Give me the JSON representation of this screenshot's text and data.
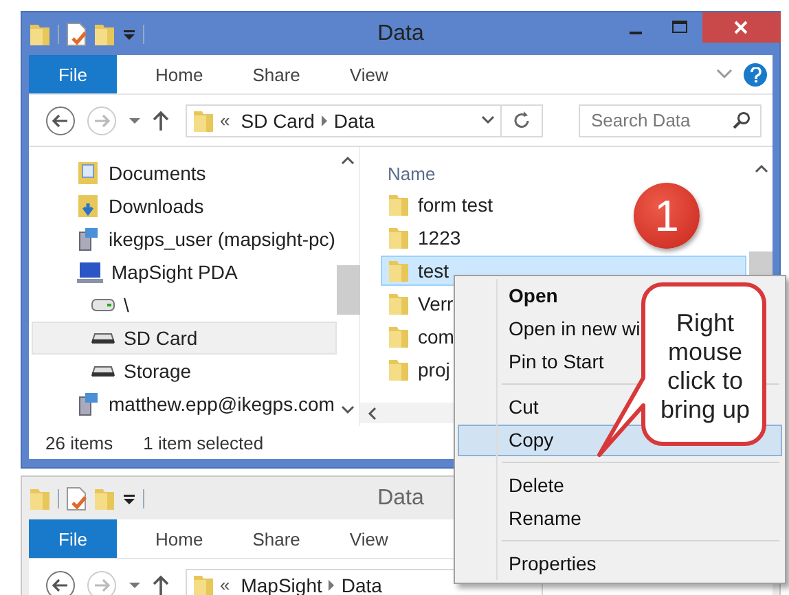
{
  "windows": [
    {
      "title": "Data",
      "active": true,
      "ribbon_tabs": [
        {
          "label": "File",
          "selected": true
        },
        {
          "label": "Home",
          "selected": false
        },
        {
          "label": "Share",
          "selected": false
        },
        {
          "label": "View",
          "selected": false
        }
      ],
      "address": {
        "overflow": "«",
        "path": [
          "SD Card",
          "Data"
        ]
      },
      "search": {
        "placeholder": "Search Data"
      },
      "nav_items": [
        {
          "label": "Documents",
          "kind": "library",
          "indent": false,
          "selected": false
        },
        {
          "label": "Downloads",
          "kind": "downloads",
          "indent": false,
          "selected": false
        },
        {
          "label": "ikegps_user (mapsight-pc)",
          "kind": "user",
          "indent": false,
          "selected": false
        },
        {
          "label": "MapSight PDA",
          "kind": "computer",
          "indent": false,
          "selected": false
        },
        {
          "label": "\\",
          "kind": "drive",
          "indent": true,
          "selected": false
        },
        {
          "label": "SD Card",
          "kind": "card",
          "indent": true,
          "selected": true
        },
        {
          "label": "Storage",
          "kind": "card",
          "indent": true,
          "selected": false
        },
        {
          "label": "matthew.epp@ikegps.com",
          "kind": "user",
          "indent": false,
          "selected": false
        }
      ],
      "column_header": "Name",
      "files": [
        {
          "name": "form test",
          "selected": false
        },
        {
          "name": "1223",
          "selected": false
        },
        {
          "name": "test",
          "selected": true
        },
        {
          "name": "Verr",
          "selected": false
        },
        {
          "name": "com",
          "selected": false
        },
        {
          "name": "proj",
          "selected": false
        }
      ],
      "status": [
        "26 items",
        "1 item selected"
      ]
    },
    {
      "title": "Data",
      "active": false,
      "ribbon_tabs": [
        {
          "label": "File",
          "selected": true
        },
        {
          "label": "Home",
          "selected": false
        },
        {
          "label": "Share",
          "selected": false
        },
        {
          "label": "View",
          "selected": false
        }
      ],
      "address": {
        "overflow": "«",
        "path": [
          "MapSight",
          "Data"
        ]
      }
    }
  ],
  "context_menu": [
    [
      {
        "label": "Open",
        "default": true,
        "selected": false
      },
      {
        "label": "Open in new wi",
        "default": false,
        "selected": false
      },
      {
        "label": "Pin to Start",
        "default": false,
        "selected": false
      }
    ],
    [
      {
        "label": "Cut",
        "default": false,
        "selected": false
      },
      {
        "label": "Copy",
        "default": false,
        "selected": true
      }
    ],
    [
      {
        "label": "Delete",
        "default": false,
        "selected": false
      },
      {
        "label": "Rename",
        "default": false,
        "selected": false
      }
    ],
    [
      {
        "label": "Properties",
        "default": false,
        "selected": false
      }
    ]
  ],
  "step_badge": "1",
  "callout": "Right mouse click to bring up"
}
